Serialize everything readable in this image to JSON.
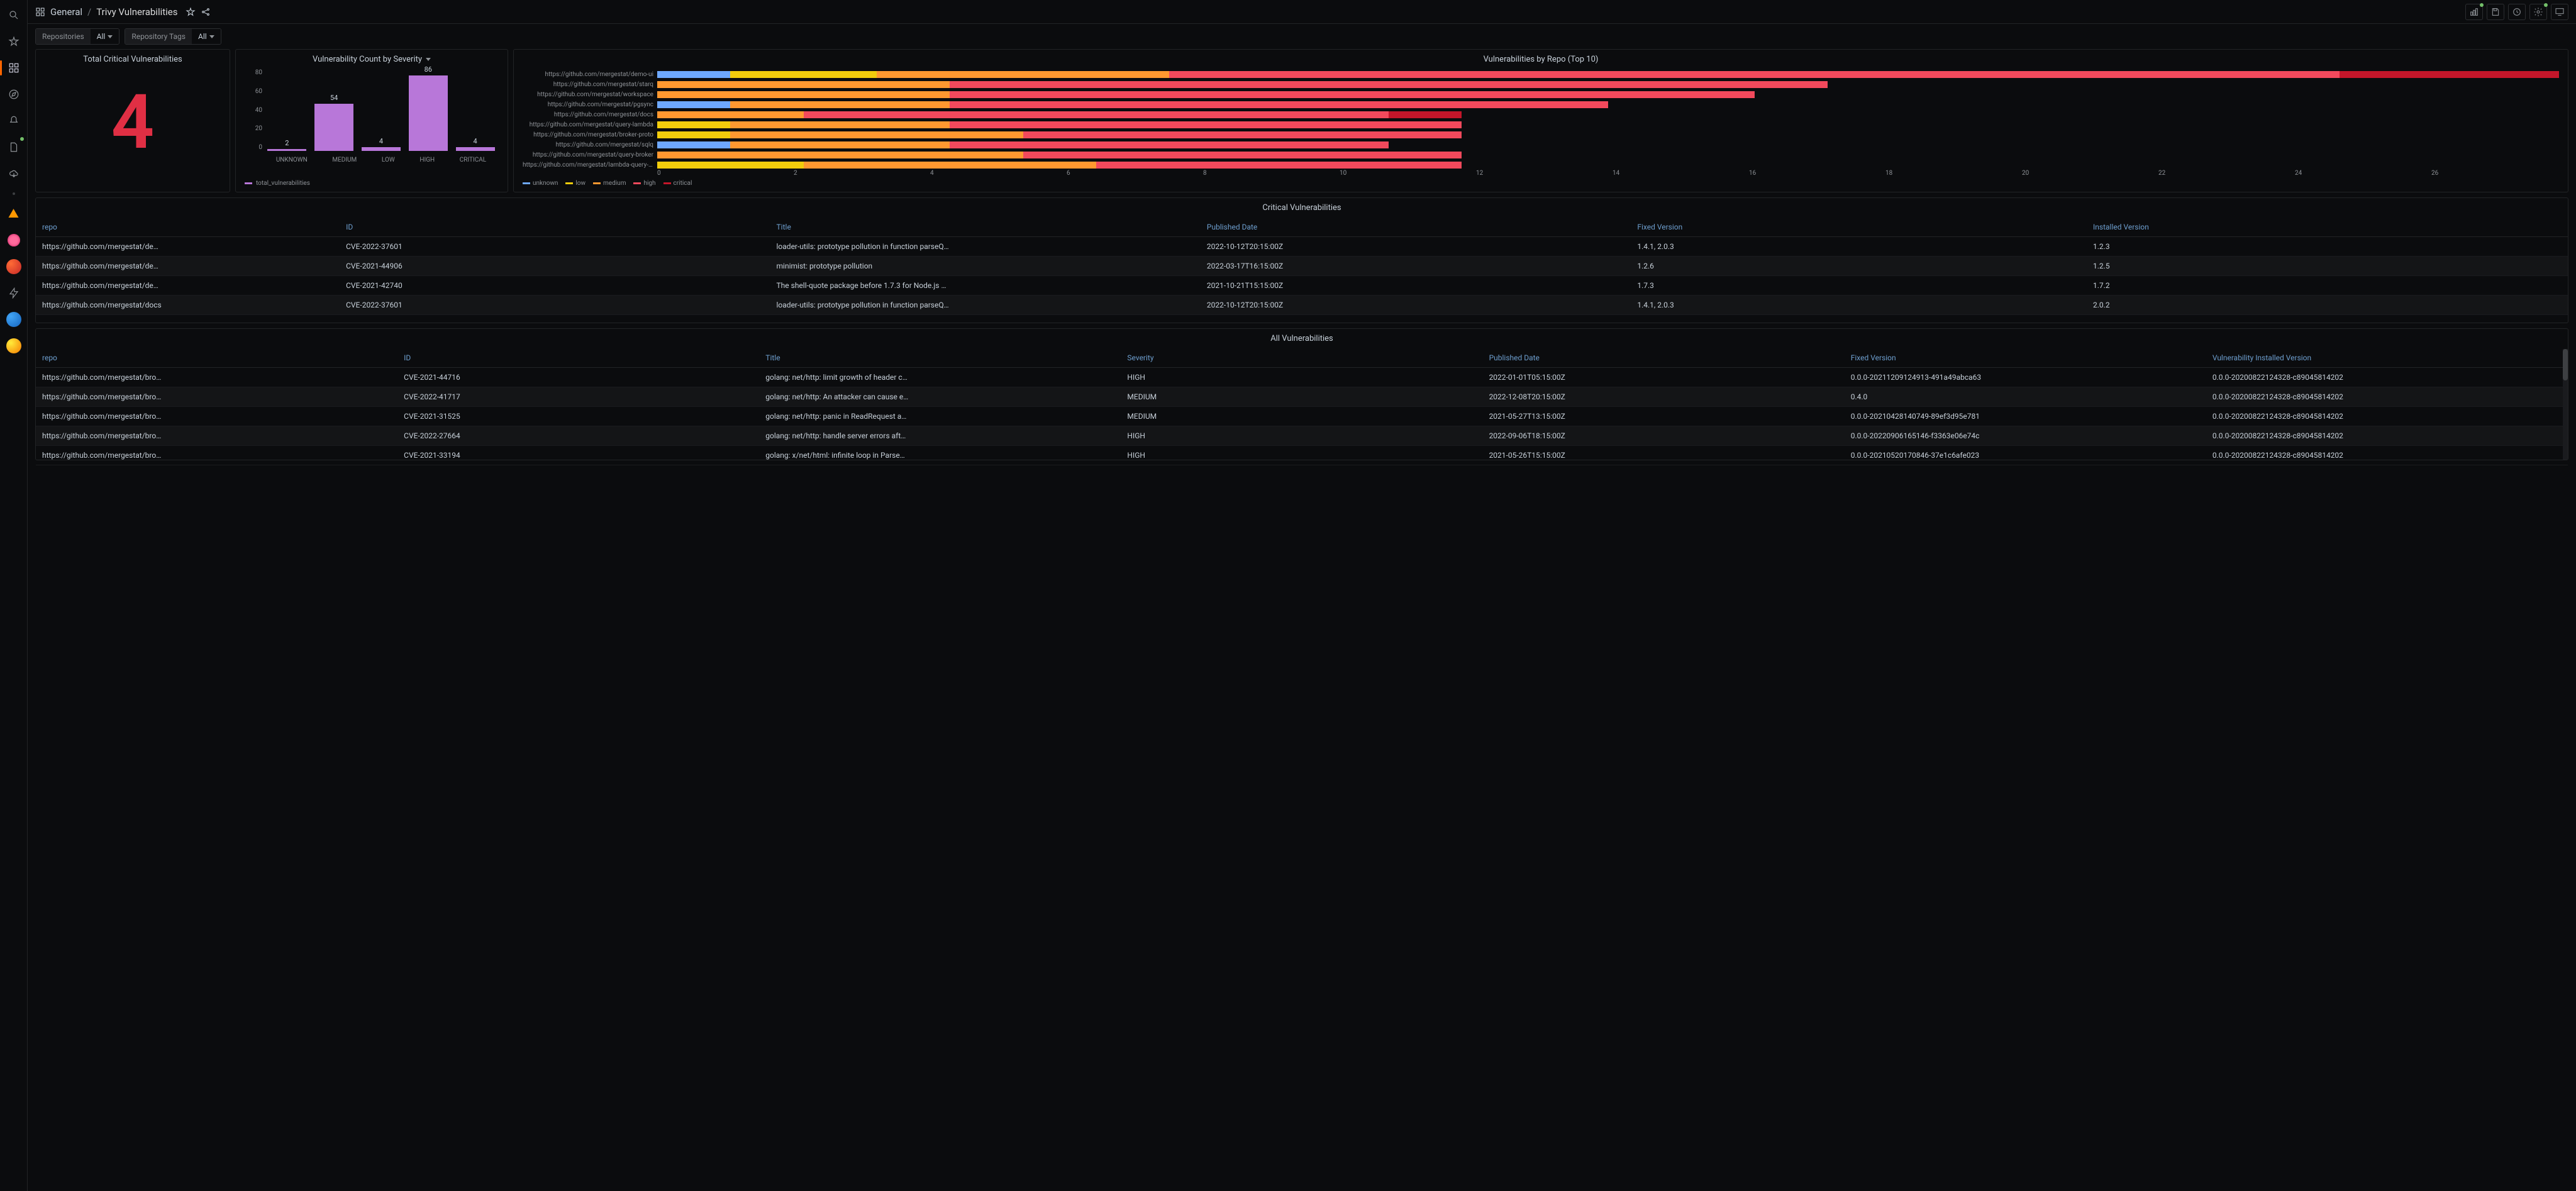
{
  "breadcrumb": {
    "folder": "General",
    "title": "Trivy Vulnerabilities"
  },
  "variables": [
    {
      "label": "Repositories",
      "value": "All"
    },
    {
      "label": "Repository Tags",
      "value": "All"
    }
  ],
  "panels": {
    "stat": {
      "title": "Total Critical Vulnerabilities",
      "value": "4"
    },
    "severity": {
      "title": "Vulnerability Count by Severity",
      "legend": "total_vulnerabilities"
    },
    "byrepo": {
      "title": "Vulnerabilities by Repo (Top 10)",
      "legend": [
        "unknown",
        "low",
        "medium",
        "high",
        "critical"
      ]
    },
    "critTable": {
      "title": "Critical Vulnerabilities",
      "cols": [
        "repo",
        "ID",
        "Title",
        "Published Date",
        "Fixed Version",
        "Installed Version"
      ],
      "rows": [
        [
          "https://github.com/mergestat/de…",
          "CVE-2022-37601",
          "loader-utils: prototype pollution in function parseQ…",
          "2022-10-12T20:15:00Z",
          "1.4.1, 2.0.3",
          "1.2.3"
        ],
        [
          "https://github.com/mergestat/de…",
          "CVE-2021-44906",
          "minimist: prototype pollution",
          "2022-03-17T16:15:00Z",
          "1.2.6",
          "1.2.5"
        ],
        [
          "https://github.com/mergestat/de…",
          "CVE-2021-42740",
          "The shell-quote package before 1.7.3 for Node.js …",
          "2021-10-21T15:15:00Z",
          "1.7.3",
          "1.7.2"
        ],
        [
          "https://github.com/mergestat/docs",
          "CVE-2022-37601",
          "loader-utils: prototype pollution in function parseQ…",
          "2022-10-12T20:15:00Z",
          "1.4.1, 2.0.3",
          "2.0.2"
        ]
      ]
    },
    "allTable": {
      "title": "All Vulnerabilities",
      "cols": [
        "repo",
        "ID",
        "Title",
        "Severity",
        "Published Date",
        "Fixed Version",
        "Vulnerability Installed Version"
      ],
      "rows": [
        [
          "https://github.com/mergestat/bro…",
          "CVE-2021-44716",
          "golang: net/http: limit growth of header c…",
          "HIGH",
          "2022-01-01T05:15:00Z",
          "0.0.0-20211209124913-491a49abca63",
          "0.0.0-20200822124328-c89045814202"
        ],
        [
          "https://github.com/mergestat/bro…",
          "CVE-2022-41717",
          "golang: net/http: An attacker can cause e…",
          "MEDIUM",
          "2022-12-08T20:15:00Z",
          "0.4.0",
          "0.0.0-20200822124328-c89045814202"
        ],
        [
          "https://github.com/mergestat/bro…",
          "CVE-2021-31525",
          "golang: net/http: panic in ReadRequest a…",
          "MEDIUM",
          "2021-05-27T13:15:00Z",
          "0.0.0-20210428140749-89ef3d95e781",
          "0.0.0-20200822124328-c89045814202"
        ],
        [
          "https://github.com/mergestat/bro…",
          "CVE-2022-27664",
          "golang: net/http: handle server errors aft…",
          "HIGH",
          "2022-09-06T18:15:00Z",
          "0.0.0-20220906165146-f3363e06e74c",
          "0.0.0-20200822124328-c89045814202"
        ],
        [
          "https://github.com/mergestat/bro…",
          "CVE-2021-33194",
          "golang: x/net/html: infinite loop in Parse…",
          "HIGH",
          "2021-05-26T15:15:00Z",
          "0.0.0-20210520170846-37e1c6afe023",
          "0.0.0-20200822124328-c89045814202"
        ]
      ]
    }
  },
  "chart_data": [
    {
      "type": "bar",
      "title": "Vulnerability Count by Severity",
      "categories": [
        "UNKNOWN",
        "MEDIUM",
        "LOW",
        "HIGH",
        "CRITICAL"
      ],
      "values": [
        2,
        54,
        4,
        86,
        4
      ],
      "ylim": [
        0,
        86
      ],
      "yticks": [
        0,
        20,
        40,
        60,
        80
      ],
      "series_name": "total_vulnerabilities",
      "color": "#b877d9"
    },
    {
      "type": "bar",
      "orientation": "horizontal_stacked",
      "title": "Vulnerabilities by Repo (Top 10)",
      "categories": [
        "https://github.com/mergestat/demo-ui",
        "https://github.com/mergestat/starq",
        "https://github.com/mergestat/workspace",
        "https://github.com/mergestat/pgsync",
        "https://github.com/mergestat/docs",
        "https://github.com/mergestat/query-lambda",
        "https://github.com/mergestat/broker-proto",
        "https://github.com/mergestat/sqlq",
        "https://github.com/mergestat/query-broker",
        "https://github.com/mergestat/lambda-query-runner"
      ],
      "series": [
        {
          "name": "unknown",
          "color": "#6ea8fe",
          "values": [
            1,
            0,
            0,
            1,
            0,
            0,
            0,
            1,
            0,
            0
          ]
        },
        {
          "name": "low",
          "color": "#f2cc0c",
          "values": [
            2,
            0,
            0,
            0,
            0,
            1,
            1,
            0,
            0,
            2
          ]
        },
        {
          "name": "medium",
          "color": "#ff9830",
          "values": [
            4,
            4,
            4,
            3,
            2,
            3,
            4,
            3,
            5,
            4
          ]
        },
        {
          "name": "high",
          "color": "#f2495c",
          "values": [
            16,
            12,
            11,
            9,
            8,
            7,
            6,
            6,
            6,
            5
          ]
        },
        {
          "name": "critical",
          "color": "#c4162a",
          "values": [
            3,
            0,
            0,
            0,
            1,
            0,
            0,
            0,
            0,
            0
          ]
        }
      ],
      "xlim": [
        0,
        26
      ],
      "xticks": [
        0,
        2,
        4,
        6,
        8,
        10,
        12,
        14,
        16,
        18,
        20,
        22,
        24,
        26
      ]
    }
  ]
}
